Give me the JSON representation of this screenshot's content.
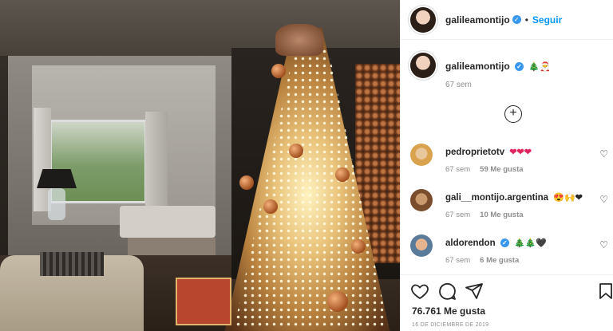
{
  "post": {
    "username": "galileamontijo",
    "follow_label": "Seguir",
    "dot": "•",
    "caption": {
      "username": "galileamontijo",
      "emojis": "🎄🎅",
      "time": "67 sem"
    },
    "load_more_label": "+",
    "comments": [
      {
        "username": "pedroprietotv",
        "emojis": "❤❤❤",
        "time": "67 sem",
        "likes": "59 Me gusta"
      },
      {
        "username": "gali__montijo.argentina",
        "emojis": "😍🙌❤",
        "time": "67 sem",
        "likes": "10 Me gusta"
      },
      {
        "username": "aldorendon",
        "emojis": "🎄🎄🖤",
        "time": "67 sem",
        "likes": "6 Me gusta"
      }
    ],
    "likes_count": "76.761 Me gusta",
    "date": "16 DE DICIEMBRE DE 2019"
  },
  "icons": {
    "verified": "verified-badge-icon",
    "like": "heart-icon",
    "comment": "comment-bubble-icon",
    "share": "paper-plane-icon",
    "save": "bookmark-icon",
    "add": "plus-circle-icon"
  },
  "colors": {
    "link": "#0095f6",
    "verified": "#3897f0",
    "muted": "#8e8e8e",
    "text": "#262626"
  }
}
